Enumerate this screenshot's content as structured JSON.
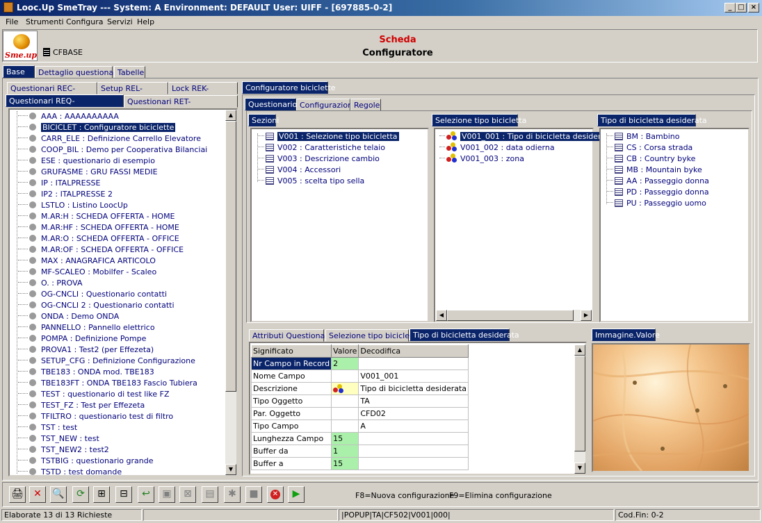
{
  "window": {
    "title": "Looc.Up SmeTray --- System: A Environment: DEFAULT User: UIFF - [697885-0-2]",
    "min": "_",
    "max": "□",
    "close": "×"
  },
  "menu": [
    "File",
    "Strumenti",
    "Configura",
    "Servizi",
    "Help"
  ],
  "logo_text": "Sme.up",
  "header": {
    "code": "CFBASE",
    "title_red": "Scheda",
    "title_black": "Configuratore"
  },
  "top_tabs": [
    "Base",
    "Dettaglio questionario",
    "Tabelle"
  ],
  "left_tabs_row1": [
    "Questionari REC-",
    "Setup REL-",
    "Lock REK-"
  ],
  "left_tabs_row2": [
    "Questionari REQ-",
    "Questionari RET-"
  ],
  "questionari": [
    {
      "code": "AAA",
      "desc": "AAAAAAAAAA"
    },
    {
      "code": "BICICLET",
      "desc": "Configuratore biciclette"
    },
    {
      "code": "CARR_ELE",
      "desc": "Definizione Carrello Elevatore"
    },
    {
      "code": "COOP_BIL",
      "desc": "Demo per Cooperativa Bilanciai"
    },
    {
      "code": "ESE",
      "desc": "questionario di esempio"
    },
    {
      "code": "GRUFASME",
      "desc": "GRU FASSI MEDIE"
    },
    {
      "code": "IP",
      "desc": "ITALPRESSE"
    },
    {
      "code": "IP2",
      "desc": "ITALPRESSE 2"
    },
    {
      "code": "LSTLO",
      "desc": "Listino LoocUp"
    },
    {
      "code": "M.AR:H",
      "desc": "SCHEDA OFFERTA - HOME"
    },
    {
      "code": "M.AR:HF",
      "desc": "SCHEDA OFFERTA - HOME"
    },
    {
      "code": "M.AR:O",
      "desc": "SCHEDA OFFERTA - OFFICE"
    },
    {
      "code": "M.AR:OF",
      "desc": "SCHEDA OFFERTA - OFFICE"
    },
    {
      "code": "MAX",
      "desc": "ANAGRAFICA ARTICOLO"
    },
    {
      "code": "MF-SCALEO",
      "desc": "Mobilfer - Scaleo"
    },
    {
      "code": "O.",
      "desc": "PROVA"
    },
    {
      "code": "OG-CNCLI",
      "desc": "Questionario contatti"
    },
    {
      "code": "OG-CNCLI 2",
      "desc": "Questionario contatti"
    },
    {
      "code": "ONDA",
      "desc": "Demo ONDA"
    },
    {
      "code": "PANNELLO",
      "desc": "Pannello elettrico"
    },
    {
      "code": "POMPA",
      "desc": "Definizione Pompe"
    },
    {
      "code": "PROVA1",
      "desc": "Test2 (per Effezeta)"
    },
    {
      "code": "SETUP_CFG",
      "desc": "Definizione Configurazione"
    },
    {
      "code": "TBE183",
      "desc": "ONDA mod. TBE183"
    },
    {
      "code": "TBE183FT",
      "desc": "ONDA TBE183 Fascio Tubiera"
    },
    {
      "code": "TEST",
      "desc": "questionario di test like FZ"
    },
    {
      "code": "TEST_FZ",
      "desc": "Test per Effezeta"
    },
    {
      "code": "TFILTRO",
      "desc": "questionario test di filtro"
    },
    {
      "code": "TST",
      "desc": "test"
    },
    {
      "code": "TST_NEW",
      "desc": "test"
    },
    {
      "code": "TST_NEW2",
      "desc": "test2"
    },
    {
      "code": "TSTBIG",
      "desc": "questionario grande"
    },
    {
      "code": "TSTD",
      "desc": "test domande"
    }
  ],
  "right_tab": "Configuratore biciclette",
  "sub_tabs": [
    "Questionario",
    "Configurazioni",
    "Regole"
  ],
  "sezioni": {
    "title": "Sezioni",
    "items": [
      {
        "code": "V001",
        "desc": "Selezione tipo bicicletta"
      },
      {
        "code": "V002",
        "desc": "Caratteristiche telaio"
      },
      {
        "code": "V003",
        "desc": "Descrizione cambio"
      },
      {
        "code": "V004",
        "desc": "Accessori"
      },
      {
        "code": "V005",
        "desc": "scelta tipo sella"
      }
    ]
  },
  "selezione": {
    "title": "Selezione tipo bicicletta",
    "items": [
      {
        "code": "V001_001",
        "desc": "Tipo di bicicletta desidera"
      },
      {
        "code": "V001_002",
        "desc": "data odierna"
      },
      {
        "code": "V001_003",
        "desc": "zona"
      }
    ]
  },
  "tipo": {
    "title": "Tipo di bicicletta desiderata",
    "items": [
      {
        "code": "BM",
        "desc": "Bambino"
      },
      {
        "code": "CS",
        "desc": "Corsa strada"
      },
      {
        "code": "CB",
        "desc": "Country byke"
      },
      {
        "code": "MB",
        "desc": "Mountain byke"
      },
      {
        "code": "AA",
        "desc": "Passeggio donna"
      },
      {
        "code": "PD",
        "desc": "Passeggio donna"
      },
      {
        "code": "PU",
        "desc": "Passeggio uomo"
      }
    ]
  },
  "bottom_tabs": [
    "Attributi Questionario",
    "Selezione tipo bicicletta",
    "Tipo di bicicletta desiderata"
  ],
  "image_tab": "Immagine.Valore",
  "table": {
    "headers": [
      "Significato",
      "Valore",
      "Decodifica"
    ],
    "rows": [
      {
        "sig": "Nr Campo in Record",
        "val": "2",
        "dec": ""
      },
      {
        "sig": "Nome Campo",
        "val": "",
        "dec": "V001_001"
      },
      {
        "sig": "Descrizione",
        "val": "",
        "dec": "Tipo di bicicletta desiderata"
      },
      {
        "sig": "Tipo Oggetto",
        "val": "",
        "dec": "TA"
      },
      {
        "sig": "Par. Oggetto",
        "val": "",
        "dec": "CFD02"
      },
      {
        "sig": "Tipo Campo",
        "val": "",
        "dec": "A"
      },
      {
        "sig": "Lunghezza Campo",
        "val": "15",
        "dec": ""
      },
      {
        "sig": "Buffer da",
        "val": "1",
        "dec": ""
      },
      {
        "sig": "Buffer a",
        "val": "15",
        "dec": ""
      }
    ]
  },
  "toolbar_hints": {
    "f8": "F8=Nuova configurazione",
    "f9": "F9=Elimina configurazione"
  },
  "status": {
    "left": "Elaborate 13 di 13 Richieste",
    "mid": "|POPUP|TA|CF502|V001|000|",
    "right": "Cod.Fin: 0-2"
  }
}
